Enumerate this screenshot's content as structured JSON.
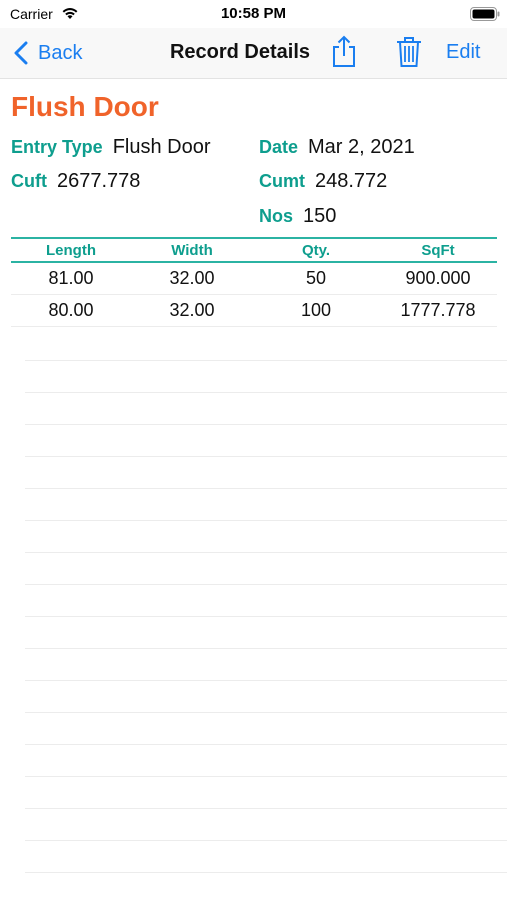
{
  "status_bar": {
    "carrier": "Carrier",
    "time": "10:58 PM"
  },
  "nav": {
    "back_label": "Back",
    "title": "Record Details",
    "edit_label": "Edit"
  },
  "record": {
    "title": "Flush Door",
    "fields": {
      "entry_type_label": "Entry Type",
      "entry_type_value": "Flush Door",
      "date_label": "Date",
      "date_value": "Mar 2, 2021",
      "cuft_label": "Cuft",
      "cuft_value": "2677.778",
      "cumt_label": "Cumt",
      "cumt_value": "248.772",
      "nos_label": "Nos",
      "nos_value": "150"
    }
  },
  "table": {
    "headers": [
      "Length",
      "Width",
      "Qty.",
      "SqFt"
    ],
    "rows": [
      [
        "81.00",
        "32.00",
        "50",
        "900.000"
      ],
      [
        "80.00",
        "32.00",
        "100",
        "1777.778"
      ]
    ]
  },
  "colors": {
    "accent_blue": "#1a7ef0",
    "title_orange": "#f0632a",
    "label_teal": "#0e9e8e",
    "rule_teal": "#2bb3a3"
  },
  "icons": {
    "back": "chevron-left-icon",
    "share": "share-icon",
    "trash": "trash-icon",
    "wifi": "wifi-icon",
    "battery": "battery-icon"
  }
}
